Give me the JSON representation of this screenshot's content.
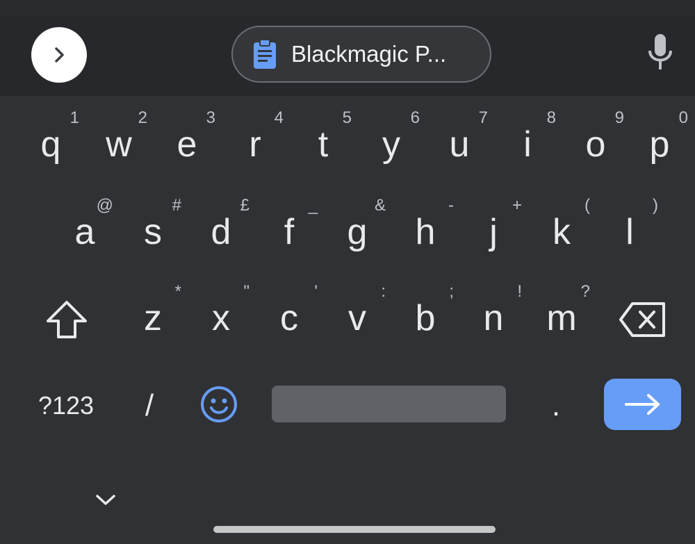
{
  "colors": {
    "background": "#303134",
    "toolbar": "#27282b",
    "accent_blue": "#669df6",
    "key_text": "#e8eaed",
    "space_bar": "#5f6368"
  },
  "toolbar": {
    "expand_icon": "chevron-right-icon",
    "clipboard_icon": "clipboard-icon",
    "clipboard_text": "Blackmagic P...",
    "mic_icon": "microphone-icon"
  },
  "rows": {
    "row1": [
      {
        "label": "q",
        "hint": "1"
      },
      {
        "label": "w",
        "hint": "2"
      },
      {
        "label": "e",
        "hint": "3"
      },
      {
        "label": "r",
        "hint": "4"
      },
      {
        "label": "t",
        "hint": "5"
      },
      {
        "label": "y",
        "hint": "6"
      },
      {
        "label": "u",
        "hint": "7"
      },
      {
        "label": "i",
        "hint": "8"
      },
      {
        "label": "o",
        "hint": "9"
      },
      {
        "label": "p",
        "hint": "0"
      }
    ],
    "row2": [
      {
        "label": "a",
        "hint": "@"
      },
      {
        "label": "s",
        "hint": "#"
      },
      {
        "label": "d",
        "hint": "£"
      },
      {
        "label": "f",
        "hint": "_"
      },
      {
        "label": "g",
        "hint": "&"
      },
      {
        "label": "h",
        "hint": "-"
      },
      {
        "label": "j",
        "hint": "+"
      },
      {
        "label": "k",
        "hint": "("
      },
      {
        "label": "l",
        "hint": ")"
      }
    ],
    "row3": [
      {
        "label": "z",
        "hint": "*"
      },
      {
        "label": "x",
        "hint": "\""
      },
      {
        "label": "c",
        "hint": "'"
      },
      {
        "label": "v",
        "hint": ":"
      },
      {
        "label": "b",
        "hint": ";"
      },
      {
        "label": "n",
        "hint": "!"
      },
      {
        "label": "m",
        "hint": "?"
      }
    ]
  },
  "bottom_row": {
    "symbols_label": "?123",
    "slash_label": "/",
    "emoji_icon": "emoji-smile-icon",
    "period_label": ".",
    "enter_icon": "arrow-right-icon"
  },
  "nav": {
    "hide_icon": "chevron-down-icon"
  }
}
